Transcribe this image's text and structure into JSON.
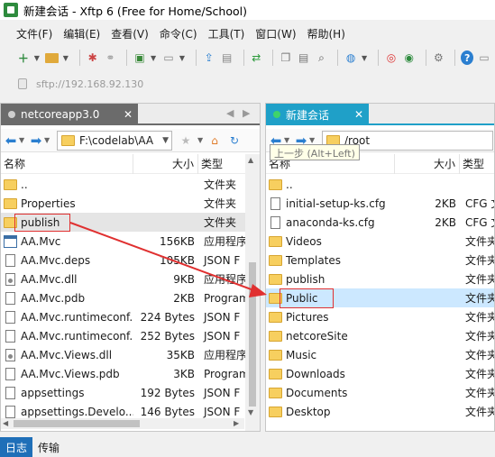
{
  "window": {
    "title": "新建会话 - Xftp 6 (Free for Home/School)"
  },
  "menu": [
    "文件(F)",
    "编辑(E)",
    "查看(V)",
    "命令(C)",
    "工具(T)",
    "窗口(W)",
    "帮助(H)"
  ],
  "address": {
    "placeholder": "sftp://192.168.92.130"
  },
  "left": {
    "tab_label": "netcoreapp3.0",
    "path": "F:\\codelab\\AA",
    "headers": {
      "name": "名称",
      "size": "大小",
      "type": "类型"
    },
    "rows": [
      {
        "name": "..",
        "size": "",
        "type": "文件夹",
        "icon": "folder"
      },
      {
        "name": "Properties",
        "size": "",
        "type": "文件夹",
        "icon": "folder"
      },
      {
        "name": "publish",
        "size": "",
        "type": "文件夹",
        "icon": "folder"
      },
      {
        "name": "AA.Mvc",
        "size": "156KB",
        "type": "应用程序",
        "icon": "exe"
      },
      {
        "name": "AA.Mvc.deps",
        "size": "105KB",
        "type": "JSON F",
        "icon": "file"
      },
      {
        "name": "AA.Mvc.dll",
        "size": "9KB",
        "type": "应用程序",
        "icon": "dll"
      },
      {
        "name": "AA.Mvc.pdb",
        "size": "2KB",
        "type": "Program",
        "icon": "file"
      },
      {
        "name": "AA.Mvc.runtimeconf...",
        "size": "224 Bytes",
        "type": "JSON F",
        "icon": "file"
      },
      {
        "name": "AA.Mvc.runtimeconf...",
        "size": "252 Bytes",
        "type": "JSON F",
        "icon": "file"
      },
      {
        "name": "AA.Mvc.Views.dll",
        "size": "35KB",
        "type": "应用程序",
        "icon": "dll"
      },
      {
        "name": "AA.Mvc.Views.pdb",
        "size": "3KB",
        "type": "Program",
        "icon": "file"
      },
      {
        "name": "appsettings",
        "size": "192 Bytes",
        "type": "JSON F",
        "icon": "file"
      },
      {
        "name": "appsettings.Develo...",
        "size": "146 Bytes",
        "type": "JSON F",
        "icon": "file"
      }
    ]
  },
  "right": {
    "tab_label": "新建会话",
    "path": "/root",
    "tooltip": "上一步 (Alt+Left)",
    "headers": {
      "name": "名称",
      "size": "大小",
      "type": "类型"
    },
    "rows": [
      {
        "name": "..",
        "size": "",
        "type": "",
        "icon": "folder"
      },
      {
        "name": "initial-setup-ks.cfg",
        "size": "2KB",
        "type": "CFG 文",
        "icon": "file"
      },
      {
        "name": "anaconda-ks.cfg",
        "size": "2KB",
        "type": "CFG 文",
        "icon": "file"
      },
      {
        "name": "Videos",
        "size": "",
        "type": "文件夹",
        "icon": "folder"
      },
      {
        "name": "Templates",
        "size": "",
        "type": "文件夹",
        "icon": "folder"
      },
      {
        "name": "publish",
        "size": "",
        "type": "文件夹",
        "icon": "folder"
      },
      {
        "name": "Public",
        "size": "",
        "type": "文件夹",
        "icon": "folder"
      },
      {
        "name": "Pictures",
        "size": "",
        "type": "文件夹",
        "icon": "folder"
      },
      {
        "name": "netcoreSite",
        "size": "",
        "type": "文件夹",
        "icon": "folder"
      },
      {
        "name": "Music",
        "size": "",
        "type": "文件夹",
        "icon": "folder"
      },
      {
        "name": "Downloads",
        "size": "",
        "type": "文件夹",
        "icon": "folder"
      },
      {
        "name": "Documents",
        "size": "",
        "type": "文件夹",
        "icon": "folder"
      },
      {
        "name": "Desktop",
        "size": "",
        "type": "文件夹",
        "icon": "folder"
      }
    ]
  },
  "bottom_tabs": [
    "日志",
    "传输"
  ],
  "colors": {
    "accent": "#1fa0c8",
    "selection": "#cce8ff",
    "annotation": "#e03030"
  }
}
